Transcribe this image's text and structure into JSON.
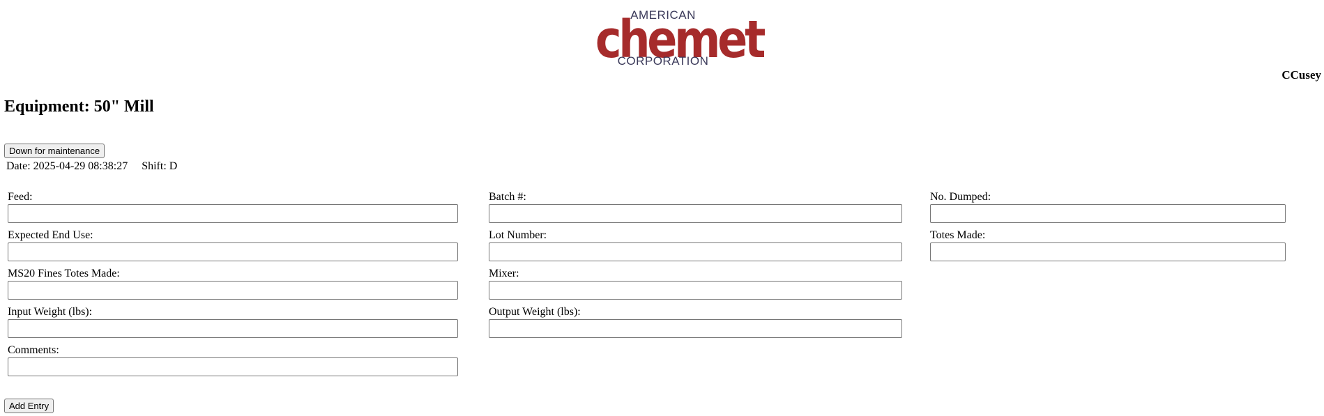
{
  "logo": {
    "top_text": "AMERICAN",
    "main_text": "chemet",
    "bottom_text": "CORPORATION"
  },
  "user": {
    "name": "CCusey"
  },
  "page": {
    "title": "Equipment: 50\" Mill"
  },
  "actions": {
    "down_label": "Down for maintenance",
    "add_label": "Add Entry"
  },
  "meta": {
    "date": "Date: 2025-04-29 08:38:27",
    "shift": "Shift: D"
  },
  "form": {
    "feed": {
      "label": "Feed:",
      "value": ""
    },
    "batch": {
      "label": "Batch #:",
      "value": ""
    },
    "dumped": {
      "label": "No. Dumped:",
      "value": ""
    },
    "end_use": {
      "label": "Expected End Use:",
      "value": ""
    },
    "lot": {
      "label": "Lot Number:",
      "value": ""
    },
    "totes": {
      "label": "Totes Made:",
      "value": ""
    },
    "fines": {
      "label": "MS20 Fines Totes Made:",
      "value": ""
    },
    "mixer": {
      "label": "Mixer:",
      "value": ""
    },
    "input_weight": {
      "label": "Input Weight (lbs):",
      "value": ""
    },
    "output_weight": {
      "label": "Output Weight (lbs):",
      "value": ""
    },
    "comments": {
      "label": "Comments:",
      "value": ""
    }
  },
  "colors": {
    "brand_red": "#a62b2b",
    "brand_navy": "#3b3a5a"
  }
}
